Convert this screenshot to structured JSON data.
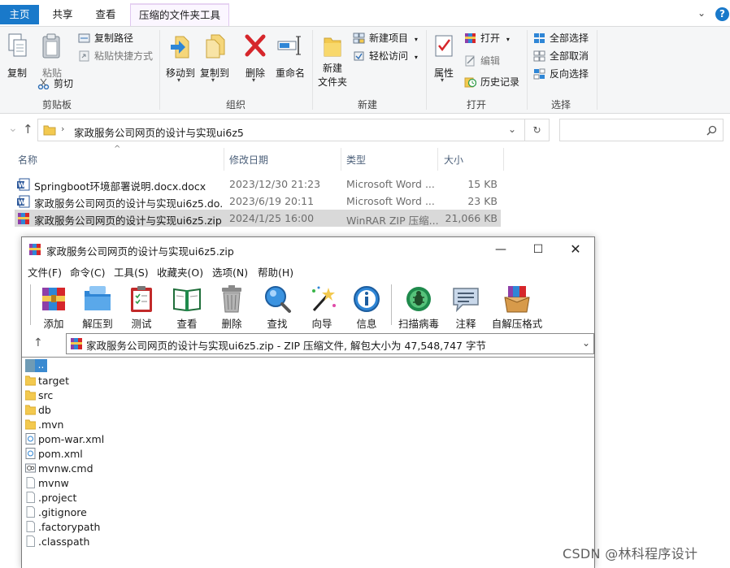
{
  "explorer": {
    "tabs": {
      "home": "主页",
      "share": "共享",
      "view": "查看",
      "compressed_tools": "压缩的文件夹工具"
    },
    "ribbon": {
      "clipboard": {
        "copy": "复制",
        "paste": "粘贴",
        "copy_path": "复制路径",
        "paste_shortcut": "粘贴快捷方式",
        "cut": "剪切",
        "group": "剪贴板"
      },
      "organize": {
        "move_to": "移动到",
        "copy_to": "复制到",
        "delete": "删除",
        "rename": "重命名",
        "group": "组织"
      },
      "new": {
        "new_folder": "新建\n文件夹",
        "new_folder_line1": "新建",
        "new_folder_line2": "文件夹",
        "new_item": "新建项目",
        "easy_access": "轻松访问",
        "group": "新建"
      },
      "open": {
        "properties": "属性",
        "open": "打开",
        "edit": "编辑",
        "history": "历史记录",
        "group": "打开"
      },
      "select": {
        "select_all": "全部选择",
        "select_none": "全部取消",
        "invert": "反向选择",
        "group": "选择"
      }
    },
    "address": {
      "path": "家政服务公司网页的设计与实现ui6z5"
    },
    "columns": {
      "name": "名称",
      "date": "修改日期",
      "type": "类型",
      "size": "大小"
    },
    "files": [
      {
        "name": "Springboot环境部署说明.docx.docx",
        "date": "2023/12/30 21:23",
        "type": "Microsoft Word ...",
        "size": "15 KB",
        "icon": "word-icon"
      },
      {
        "name": "家政服务公司网页的设计与实现ui6z5.do...",
        "date": "2023/6/19 20:11",
        "type": "Microsoft Word ...",
        "size": "23 KB",
        "icon": "word-icon"
      },
      {
        "name": "家政服务公司网页的设计与实现ui6z5.zip",
        "date": "2024/1/25 16:00",
        "type": "WinRAR ZIP 压缩...",
        "size": "21,066 KB",
        "icon": "winrar-icon"
      }
    ]
  },
  "winrar": {
    "title": "家政服务公司网页的设计与实现ui6z5.zip",
    "menus": [
      "文件(F)",
      "命令(C)",
      "工具(S)",
      "收藏夹(O)",
      "选项(N)",
      "帮助(H)"
    ],
    "toolbar": [
      "添加",
      "解压到",
      "测试",
      "查看",
      "删除",
      "查找",
      "向导",
      "信息",
      "扫描病毒",
      "注释",
      "自解压格式"
    ],
    "path_info": "家政服务公司网页的设计与实现ui6z5.zip - ZIP 压缩文件, 解包大小为 47,548,747 字节",
    "entries": [
      {
        "name": "..",
        "kind": "updir"
      },
      {
        "name": "target",
        "kind": "folder"
      },
      {
        "name": "src",
        "kind": "folder"
      },
      {
        "name": "db",
        "kind": "folder"
      },
      {
        "name": ".mvn",
        "kind": "folder"
      },
      {
        "name": "pom-war.xml",
        "kind": "xml"
      },
      {
        "name": "pom.xml",
        "kind": "xml"
      },
      {
        "name": "mvnw.cmd",
        "kind": "cmd"
      },
      {
        "name": "mvnw",
        "kind": "file"
      },
      {
        "name": ".project",
        "kind": "file"
      },
      {
        "name": ".gitignore",
        "kind": "file"
      },
      {
        "name": ".factorypath",
        "kind": "file"
      },
      {
        "name": ".classpath",
        "kind": "file"
      }
    ]
  },
  "watermark": "CSDN @林科程序设计",
  "colors": {
    "accent": "#1979ca",
    "selection": "#d9d9d9",
    "winrar_selected": "#3a8ad0"
  }
}
